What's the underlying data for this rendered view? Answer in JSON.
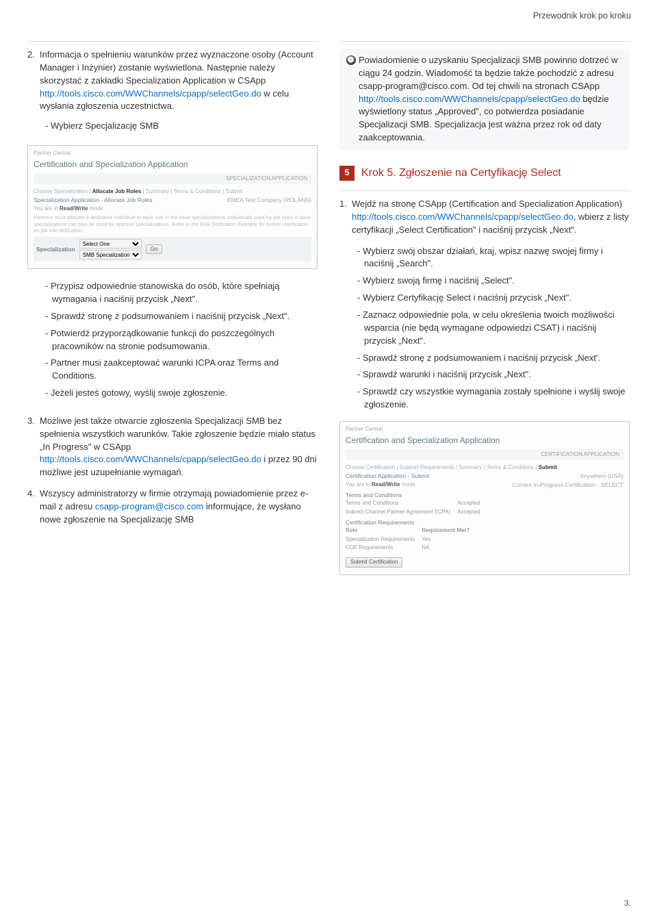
{
  "header": {
    "breadcrumb": "Przewodnik krok po kroku"
  },
  "left": {
    "p2_num": "2.",
    "p2_text_a": "Informacja o spełnieniu warunków przez wyznaczone osoby (Account Manager i Inżynier) zostanie wyświetlona. Następnie należy skorzystać z zakładki Specialization Application w CSApp ",
    "p2_link": "http://tools.cisco.com/WWChannels/cpapp/selectGeo.do",
    "p2_text_b": " w celu wysłania zgłoszenia uczestnictwa.",
    "p2_sub": "Wybierz Specjalizację SMB",
    "shot1": {
      "partner_central": "Partner Central",
      "title": "Certification and Specialization Application",
      "bar_right": "SPECIALIZATION APPLICATION",
      "breadcrumb_items": [
        "Choose Specialization",
        "Allocate Job Roles",
        "Summary",
        "Terms & Conditions",
        "Submit"
      ],
      "row_l": "Specialization Application - Allocate Job Roles",
      "row_r": "EMEA Test Company (POLAND)",
      "mode_pre": "You are in ",
      "mode_strong": "Read/Write",
      "mode_post": " mode",
      "blurb": "Partners must allocate a dedicated individual to each role in the base specializations. Individuals used for job roles in base specializations can also be used for optional specializations. Refer to the Role Dedication Example for further clarification on job role dedication.",
      "spec_label": "Specialization",
      "opt1": "Select One",
      "opt2": "SMB Specialization",
      "go_btn": "Go"
    },
    "b1": "Przypisz odpowiednie stanowiska do osób, które spełniają wymagania i naciśnij przycisk „Next\".",
    "b2": "Sprawdź stronę z podsumowaniem i naciśnij przycisk „Next\".",
    "b3": "Potwierdź przyporządkowanie funkcji do poszczególnych pracowników na stronie podsumowania.",
    "b4": "Partner musi zaakceptować warunki ICPA oraz Terms and Conditions.",
    "b5": "Jeżeli jesteś gotowy, wyślij swoje zgłoszenie.",
    "p3_num": "3.",
    "p3_text_a": "Możliwe jest także otwarcie zgłoszenia Specjalizacji SMB bez spełnienia wszystkich warunków. Takie zgłoszenie będzie miało status „In Progress\" w CSApp ",
    "p3_link": "http://tools.cisco.com/WWChannels/cpapp/selectGeo.do",
    "p3_text_b": " i przez 90 dni możliwe jest uzupełnianie wymagań.",
    "p4_num": "4.",
    "p4_text_a": "Wszyscy administratorzy w firmie otrzymają powiadomienie przez e-mail z adresu ",
    "p4_email": "csapp-program@cisco.com",
    "p4_text_b": " informujące, że wysłano nowe zgłoszenie na  Specjalizację SMB"
  },
  "right": {
    "note_a": "Powiadomienie o uzyskaniu Specjalizacji SMB powinno dotrzeć w ciągu 24 godzin. Wiadomość ta będzie także pochodzić z adresu csapp-program@cisco.com. Od tej chwili na stronach CSApp ",
    "note_link": "http://tools.cisco.com/WWChannels/cpapp/selectGeo.do",
    "note_b": " będzie wyświetlony status „Approved\", co potwierdza posiadanie Specjalizacji SMB. Specjalizacja jest ważna przez  rok od daty zaakceptowania.",
    "step5_num": "5",
    "step5_label": "Krok 5. Zgłoszenie na Certyfikację Select",
    "r1_num": "1.",
    "r1_text_a": "Wejdź na stronę CSApp (Certification and Specialization Application) ",
    "r1_link": "http://tools.cisco.com/WWChannels/cpapp/selectGeo.do",
    "r1_text_b": ", wbierz z listy certyfikacji „Select Certification\" i naciśnij przycisk „Next\".",
    "rb1": "Wybierz swój obszar działań, kraj, wpisz nazwę swojej firmy i naciśnij „Search\".",
    "rb2": "Wybierz swoją firmę i naciśnij „Select\".",
    "rb3": "Wybierz Certyfikację Select i naciśnij przycisk „Next\".",
    "rb4": "Zaznacz odpowiednie pola, w celu określenia twoich możliwości wsparcia (nie będą wymagane odpowiedzi CSAT) i naciśnij przycisk „Next\".",
    "rb5": "Sprawdź stronę z podsumowaniem i naciśnij przycisk „Next'.",
    "rb6": "Sprawdź warunki i naciśnij przycisk „Next\".",
    "rb7": "Sprawdź czy wszystkie wymagania zostały spełnione i wyślij swoje zgłoszenie.",
    "shot2": {
      "partner_central": "Partner Central",
      "title": "Certification and Specialization Application",
      "bar_right": "CERTIFICATION APPLICATION",
      "breadcrumb_items": [
        "Choose Certification",
        "Support Requirements",
        "Summary",
        "Terms & Conditions",
        "Submit"
      ],
      "row_l": "Certification Application - Submit",
      "row_r1": "Anywhere (USA)",
      "mode_pre": "You are in ",
      "mode_strong": "Read/Write",
      "mode_post": " mode",
      "row_r2": "Current In-Progress Certification - SELECT",
      "sect_tc": "Terms and Conditions",
      "tc1_l": "Terms and Conditions",
      "tc1_r": "Accepted",
      "tc2_l": "Indirect Channel Partner Agreement (ICPA)",
      "tc2_r": "Accepted",
      "sect_cr": "Certification Requirements",
      "cr_h1": "Role",
      "cr_h2": "Requirement Met?",
      "cr1_l": "Specialization Requirements",
      "cr1_r": "Yes",
      "cr2_l": "COE Requirements",
      "cr2_r": "NA",
      "submit_btn": "Submit Certification"
    }
  },
  "page_number": "3."
}
